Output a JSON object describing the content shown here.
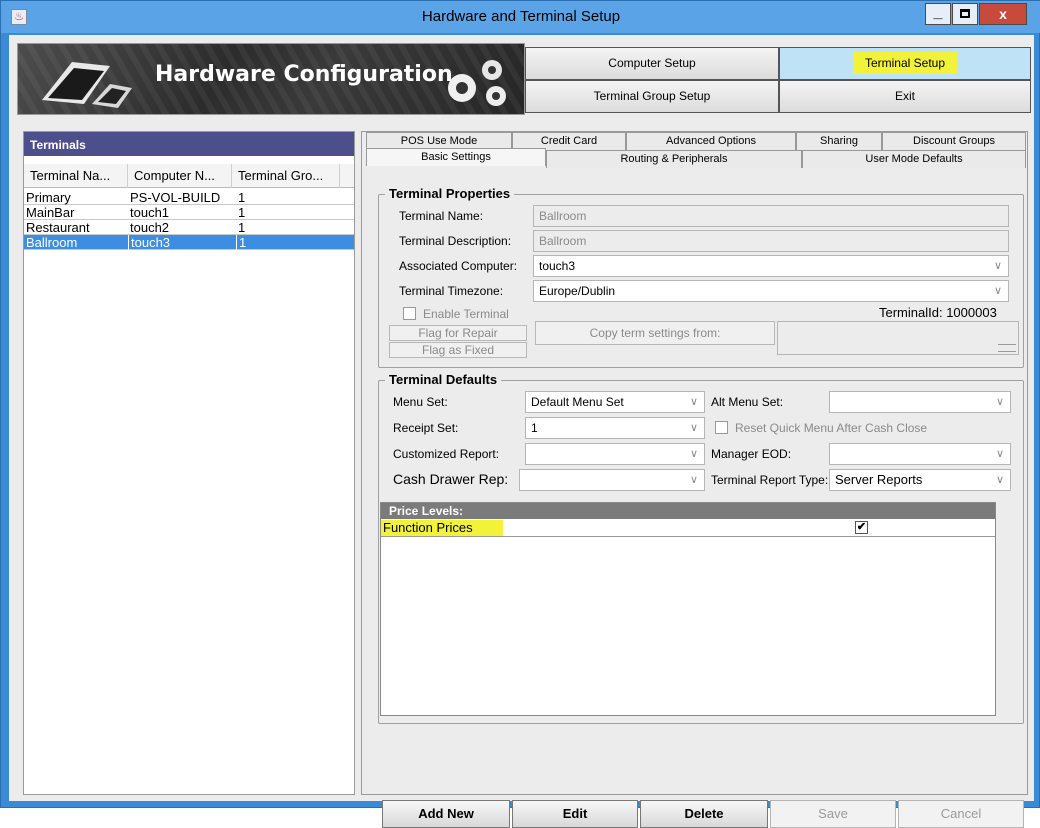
{
  "window": {
    "title": "Hardware and Terminal Setup",
    "close_label": "x",
    "minimize_label": "_"
  },
  "banner": {
    "title": "Hardware Configuration"
  },
  "nav": {
    "computer_setup": "Computer Setup",
    "terminal_setup": "Terminal Setup",
    "terminal_group_setup": "Terminal Group Setup",
    "exit": "Exit"
  },
  "terminals": {
    "header": "Terminals",
    "columns": [
      "Terminal Na...",
      "Computer N...",
      "Terminal Gro..."
    ],
    "rows": [
      [
        "Primary",
        "PS-VOL-BUILD",
        "1"
      ],
      [
        "MainBar",
        "touch1",
        "1"
      ],
      [
        "Restaurant",
        "touch2",
        "1"
      ],
      [
        "Ballroom",
        "touch3",
        "1"
      ]
    ],
    "selected_index": 3
  },
  "tabs": {
    "row1": [
      "POS Use Mode",
      "Credit Card",
      "Advanced Options",
      "Sharing",
      "Discount Groups"
    ],
    "row2": [
      "Basic Settings",
      "Routing & Peripherals",
      "User Mode Defaults"
    ],
    "active": "Basic Settings"
  },
  "terminal_properties": {
    "legend": "Terminal Properties",
    "name_label": "Terminal Name:",
    "name_value": "Ballroom",
    "description_label": "Terminal Description:",
    "description_value": "Ballroom",
    "computer_label": "Associated Computer:",
    "computer_value": "touch3",
    "timezone_label": "Terminal Timezone:",
    "timezone_value": "Europe/Dublin",
    "enable_label": "Enable Terminal",
    "terminal_id": "TerminalId: 1000003",
    "flag_repair": "Flag for Repair",
    "flag_fixed": "Flag as Fixed",
    "copy_settings": "Copy term settings from:"
  },
  "terminal_defaults": {
    "legend": "Terminal Defaults",
    "menu_set_label": "Menu Set:",
    "menu_set_value": "Default Menu Set",
    "alt_menu_set_label": "Alt Menu Set:",
    "receipt_set_label": "Receipt Set:",
    "receipt_set_value": "1",
    "reset_quick_menu_label": "Reset Quick Menu After Cash Close",
    "customized_report_label": "Customized Report:",
    "manager_eod_label": "Manager EOD:",
    "cash_drawer_label": "Cash Drawer Rep:",
    "report_type_label": "Terminal Report Type:",
    "report_type_value": "Server Reports",
    "price_levels_header": "Price Levels:",
    "price_levels": [
      {
        "name": "Function Prices",
        "checked": true
      }
    ],
    "check_mark": "✔"
  },
  "actions": {
    "add_new": "Add New",
    "edit": "Edit",
    "delete": "Delete",
    "save": "Save",
    "cancel": "Cancel"
  },
  "dropdown_glyph": "∨",
  "colors": {
    "highlight": "#f2f23a",
    "selection": "#3d8ee0",
    "panel_header": "#4d4f8c",
    "title_bar": "#5aa3e6"
  }
}
